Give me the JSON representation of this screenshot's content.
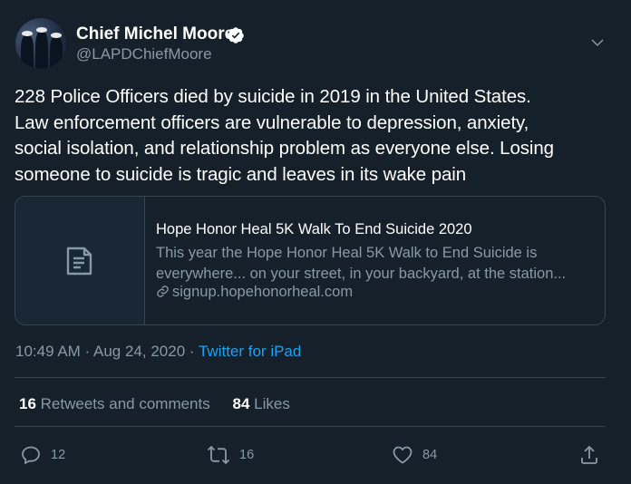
{
  "author": {
    "name": "Chief Michel Moore",
    "handle": "@LAPDChiefMoore",
    "verified_icon": "verified-badge-icon"
  },
  "tweet": {
    "lines": [
      "228 Police Officers died by suicide in 2019 in the United States.",
      "Law enforcement officers are vulnerable to depression, anxiety,",
      "social isolation, and relationship problem as everyone else.  Losing",
      "someone to suicide is tragic and leaves in its wake pain"
    ]
  },
  "card": {
    "title": "Hope Honor Heal 5K Walk To End Suicide 2020",
    "desc_lines": [
      "This year the Hope Honor Heal 5K Walk to End Suicide is",
      "everywhere... on your street, in your backyard, at the station..."
    ],
    "link": "signup.hopehonorheal.com"
  },
  "meta": {
    "time": "10:49 AM",
    "sep1": " · ",
    "date": "Aug 24, 2020",
    "sep2": " · ",
    "source": "Twitter for iPad"
  },
  "stats": {
    "retweets_count": "16",
    "retweets_label": "Retweets and comments",
    "likes_count": "84",
    "likes_label": "Likes"
  },
  "actions": {
    "reply_count": "12",
    "retweet_count": "16",
    "like_count": "84"
  },
  "colors": {
    "background": "#15202b",
    "text": "#ffffff",
    "muted": "#8899a6",
    "link": "#1da1f2",
    "border": "#38444d"
  }
}
